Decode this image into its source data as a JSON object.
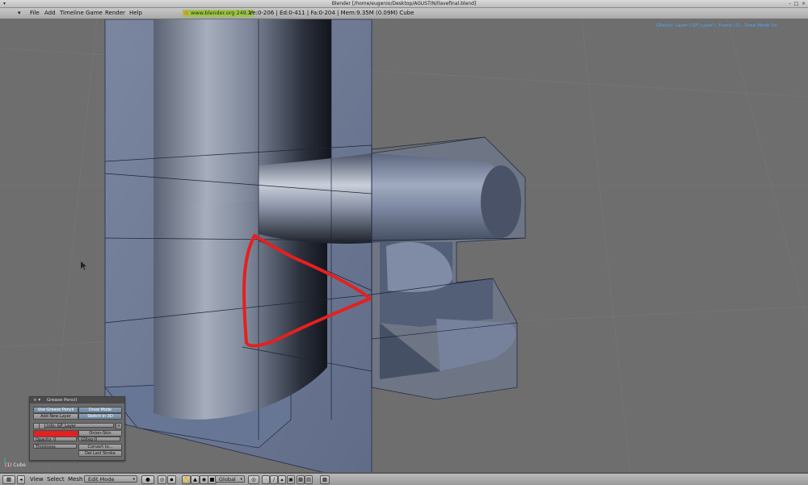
{
  "window": {
    "title": "Blender [/home/eugenio/Desktop/AGUSTIN/llavefinal.blend]"
  },
  "menubar": {
    "items": [
      "File",
      "Add",
      "Timeline",
      "Game",
      "Render",
      "Help"
    ],
    "url": "www.blender.org 249.2",
    "stats": "Ve:0-206 | Ed:0-411 | Fa:0-204 | Mem:9.35M (0.09M) Cube"
  },
  "viewport": {
    "gpencil_status": "GPencil: Layer ('GP_Layer'), Frame (1) : Draw Mode On",
    "object_name": "(1) Cube",
    "stroke_color": "#e52020"
  },
  "grease_panel": {
    "title": "Grease Pencil",
    "use_grease_pencil": "Use Grease Pencil",
    "draw_mode": "Draw Mode",
    "add_new_layer": "Add New Layer",
    "sketch_in_3d": "Sketch in 3D",
    "layer_name": "Info: GP_Layer",
    "onion_skin": "Onion-Skin",
    "opacity": "Opacity: 0",
    "gstep": "GStep:0",
    "thickness": "Thickness",
    "convert_to": "Convert to...",
    "del_last_stroke": "Del Last Stroke"
  },
  "bottombar": {
    "items": [
      "View",
      "Select",
      "Mesh"
    ],
    "mode": "Edit Mode",
    "orientation": "Global"
  }
}
